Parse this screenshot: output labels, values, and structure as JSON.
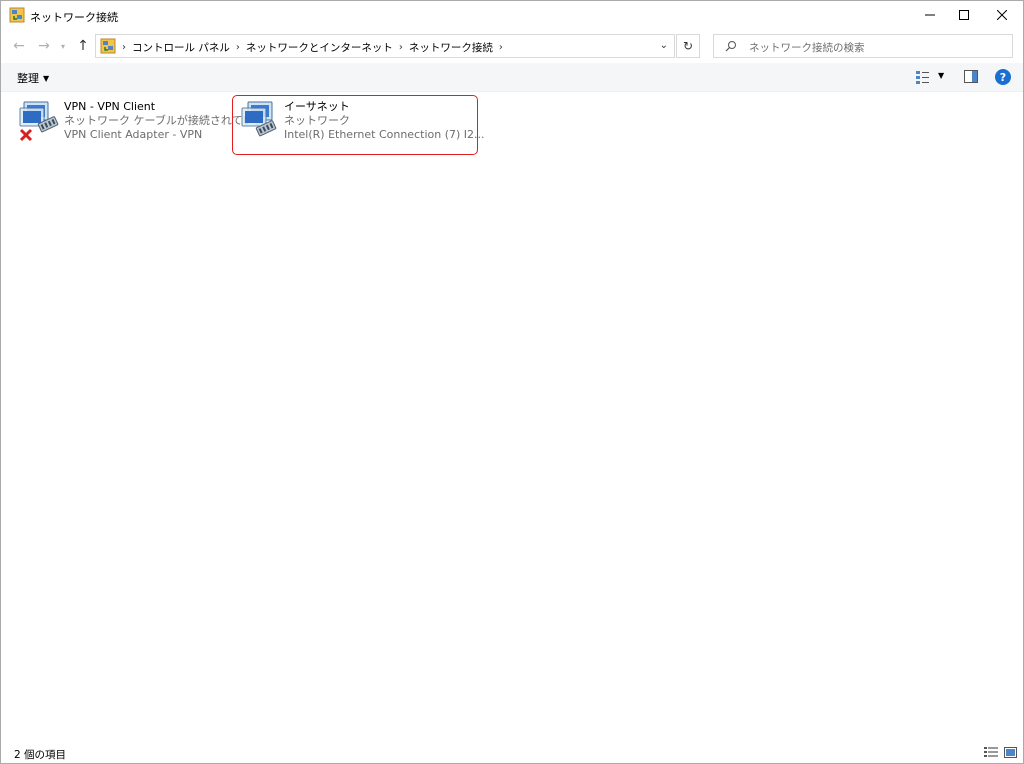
{
  "window": {
    "title": "ネットワーク接続",
    "minimize": "—",
    "maximize": "☐",
    "close": "✕"
  },
  "nav": {
    "back": "←",
    "forward": "→",
    "recent": "▾",
    "up": "↑"
  },
  "address": {
    "crumbs": [
      "コントロール パネル",
      "ネットワークとインターネット",
      "ネットワーク接続"
    ],
    "separator": "›",
    "dropdown": "⌄",
    "refresh": "↻"
  },
  "search": {
    "placeholder": "ネットワーク接続の検索"
  },
  "commandbar": {
    "organize_label": "整理",
    "organize_arrow": "▼",
    "view_arrow": "▼",
    "help_label": "?"
  },
  "items": [
    {
      "name": "VPN - VPN Client",
      "status": "ネットワーク ケーブルが接続されていま...",
      "adapter": "VPN Client Adapter - VPN",
      "icon": "network-adapter-disconnected-icon"
    },
    {
      "name": "イーサネット",
      "status": "ネットワーク",
      "adapter": "Intel(R) Ethernet Connection (7) I2...",
      "icon": "network-adapter-icon"
    }
  ],
  "status": {
    "count": "2 個の項目"
  },
  "colors": {
    "highlight": "#e02020",
    "help": "#1a6fd1"
  }
}
